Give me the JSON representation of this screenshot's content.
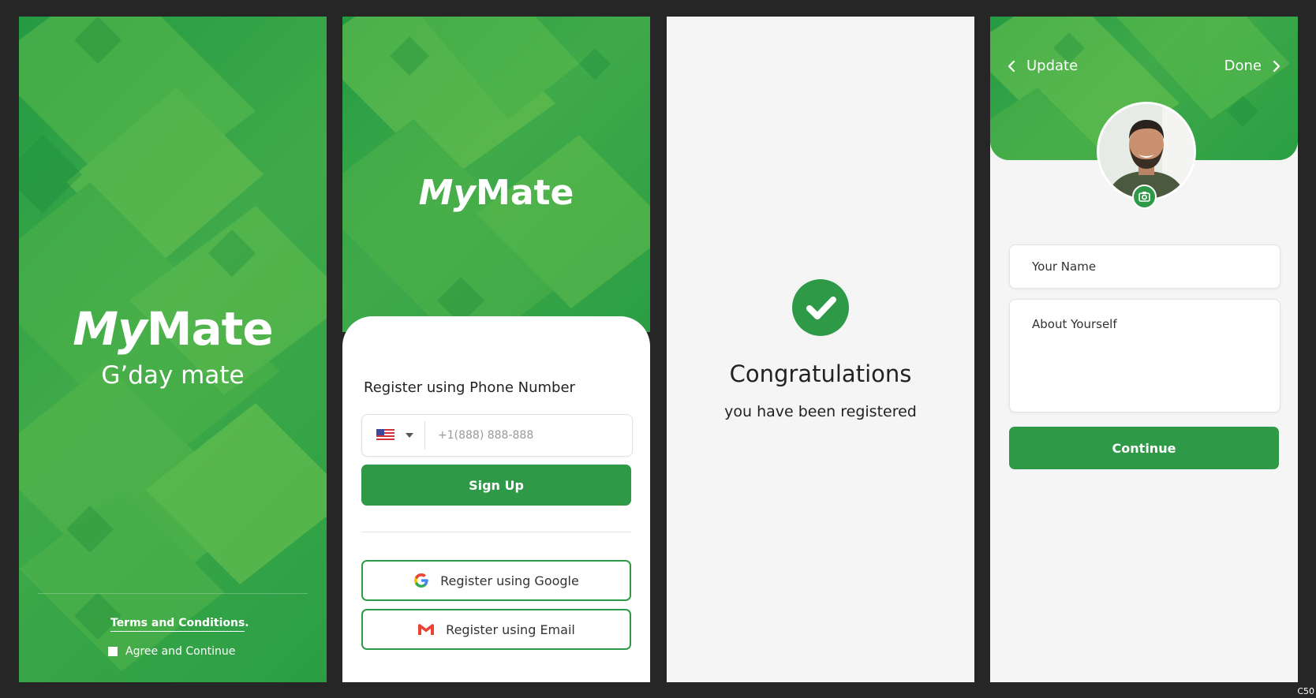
{
  "colors": {
    "brand_green": "#2e9a48",
    "background": "#262626",
    "screen_bg": "#f5f5f5"
  },
  "splash": {
    "logo_my": "My",
    "logo_mate": "Mate",
    "tagline": "G’day mate",
    "terms_link": "Terms and Conditions",
    "terms_period": ".",
    "agree_label": "Agree and Continue"
  },
  "register": {
    "logo_my": "My",
    "logo_mate": "Mate",
    "title": "Register using Phone Number",
    "country_icon": "us-flag-icon",
    "phone_placeholder": "+1(888) 888-888",
    "signup_label": "Sign Up",
    "google_label": "Register using Google",
    "email_label": "Register using Email"
  },
  "success": {
    "icon": "check-circle-icon",
    "title": "Congratulations",
    "subtitle": "you have been registered"
  },
  "profile": {
    "back_label": "Update",
    "done_label": "Done",
    "name_placeholder": "Your Name",
    "about_placeholder": "About Yourself",
    "continue_label": "Continue"
  },
  "corner_label": "C50"
}
